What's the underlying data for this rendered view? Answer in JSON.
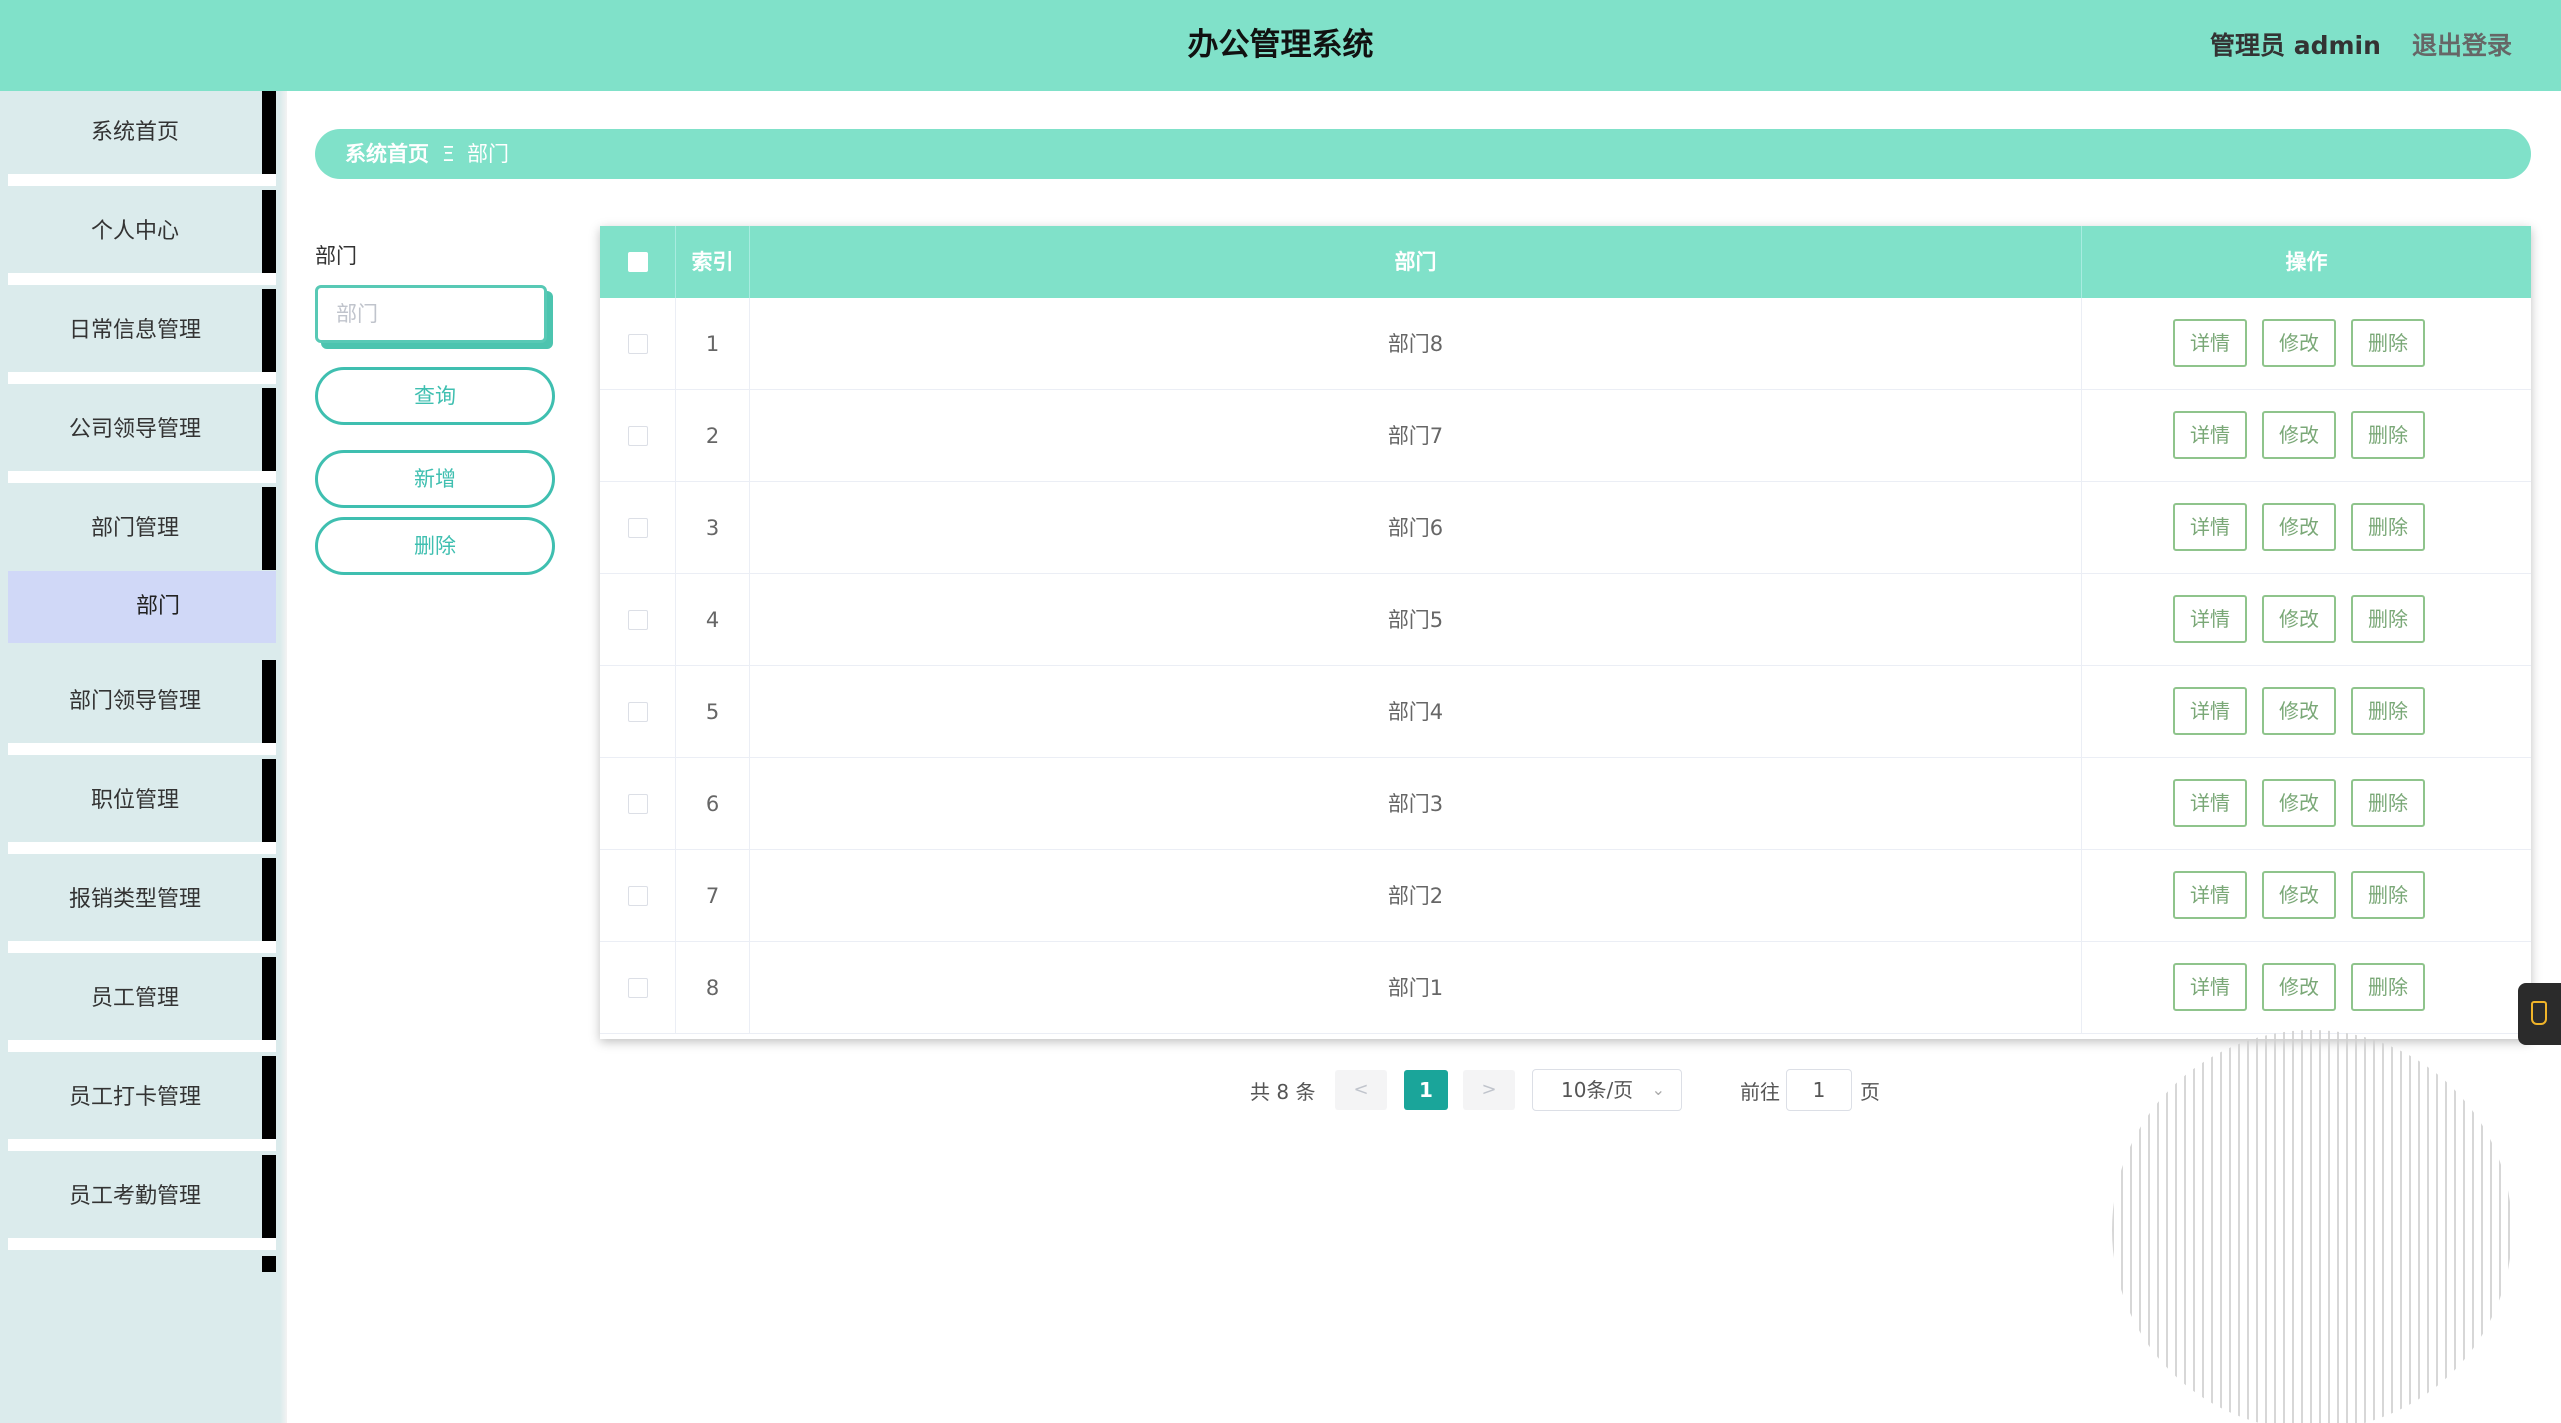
{
  "header": {
    "title": "办公管理系统",
    "user": "管理员 admin",
    "logout": "退出登录"
  },
  "sidebar": {
    "items": [
      {
        "label": "系统首页"
      },
      {
        "label": "个人中心"
      },
      {
        "label": "日常信息管理"
      },
      {
        "label": "公司领导管理"
      },
      {
        "label": "部门管理"
      },
      {
        "label": "部门领导管理"
      },
      {
        "label": "职位管理"
      },
      {
        "label": "报销类型管理"
      },
      {
        "label": "员工管理"
      },
      {
        "label": "员工打卡管理"
      },
      {
        "label": "员工考勤管理"
      }
    ],
    "submenu": {
      "label": "部门"
    }
  },
  "breadcrumb": {
    "home": "系统首页",
    "separator": "Ξ",
    "current": "部门"
  },
  "search": {
    "label": "部门",
    "placeholder": "部门",
    "query_btn": "查询",
    "add_btn": "新增",
    "delete_btn": "删除"
  },
  "table": {
    "headers": {
      "index": "索引",
      "dept": "部门",
      "ops": "操作"
    },
    "rows": [
      {
        "index": "1",
        "dept": "部门8"
      },
      {
        "index": "2",
        "dept": "部门7"
      },
      {
        "index": "3",
        "dept": "部门6"
      },
      {
        "index": "4",
        "dept": "部门5"
      },
      {
        "index": "5",
        "dept": "部门4"
      },
      {
        "index": "6",
        "dept": "部门3"
      },
      {
        "index": "7",
        "dept": "部门2"
      },
      {
        "index": "8",
        "dept": "部门1"
      }
    ],
    "actions": {
      "detail": "详情",
      "edit": "修改",
      "delete": "删除"
    }
  },
  "pagination": {
    "total": "共 8 条",
    "prev": "<",
    "current": "1",
    "next": ">",
    "page_size": "10条/页",
    "goto": "前往",
    "goto_value": "1",
    "page_unit": "页"
  },
  "colors": {
    "accent": "#80e1c9",
    "sidebar_bg": "#dbebec",
    "active_submenu": "#d0d8f7",
    "button_border": "#3fbfb0",
    "action_green": "#8fc48c",
    "page_active": "#1aa59a"
  }
}
